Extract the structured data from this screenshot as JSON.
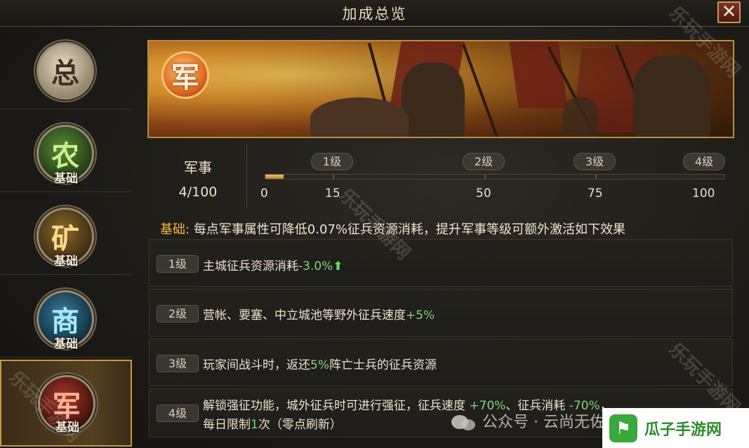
{
  "window": {
    "title": "加成总览",
    "close_label": "✕"
  },
  "sidebar": {
    "items": [
      {
        "glyph": "总",
        "sub": ""
      },
      {
        "glyph": "农",
        "sub": "基础"
      },
      {
        "glyph": "矿",
        "sub": "基础"
      },
      {
        "glyph": "商",
        "sub": "基础"
      },
      {
        "glyph": "军",
        "sub": "基础"
      }
    ],
    "active_index": 4
  },
  "banner": {
    "emblem": "军"
  },
  "stat": {
    "label": "军事",
    "value": "4/100",
    "progress_fraction": 0.04
  },
  "levels": {
    "pills": [
      "1级",
      "2级",
      "3级",
      "4级"
    ],
    "ticks": [
      "0",
      "15",
      "50",
      "75",
      "100"
    ]
  },
  "description": {
    "prefix": "基础:",
    "text": "每点军事属性可降低0.07%征兵资源消耗，提升军事等级可额外激活如下效果"
  },
  "rows": [
    {
      "badge": "1级",
      "text": "主城征兵资源消耗",
      "value": "-3.0%",
      "arrow": "⬆"
    },
    {
      "badge": "2级",
      "text": "营帐、要塞、中立城池等野外征兵速度",
      "value": "+5%"
    },
    {
      "badge": "3级",
      "text_a": "玩家间战斗时，返还",
      "value": "5%",
      "text_b": "阵亡士兵的征兵资源"
    },
    {
      "badge": "4级",
      "line1_a": "解锁强征功能，城外征兵时可进行强征，征兵速度 ",
      "line1_v1": "+70%",
      "line1_b": "、征兵消耗 ",
      "line1_v2": "-70%",
      "line1_c": "，",
      "line2_a": "每日限制",
      "line2_v": "1",
      "line2_b": "次（零点刷新）"
    }
  ],
  "watermarks": {
    "site": "乐玩手游网",
    "wechat": "公众号 · 云尚无佐宫 号游",
    "brand": "瓜子手游网"
  }
}
